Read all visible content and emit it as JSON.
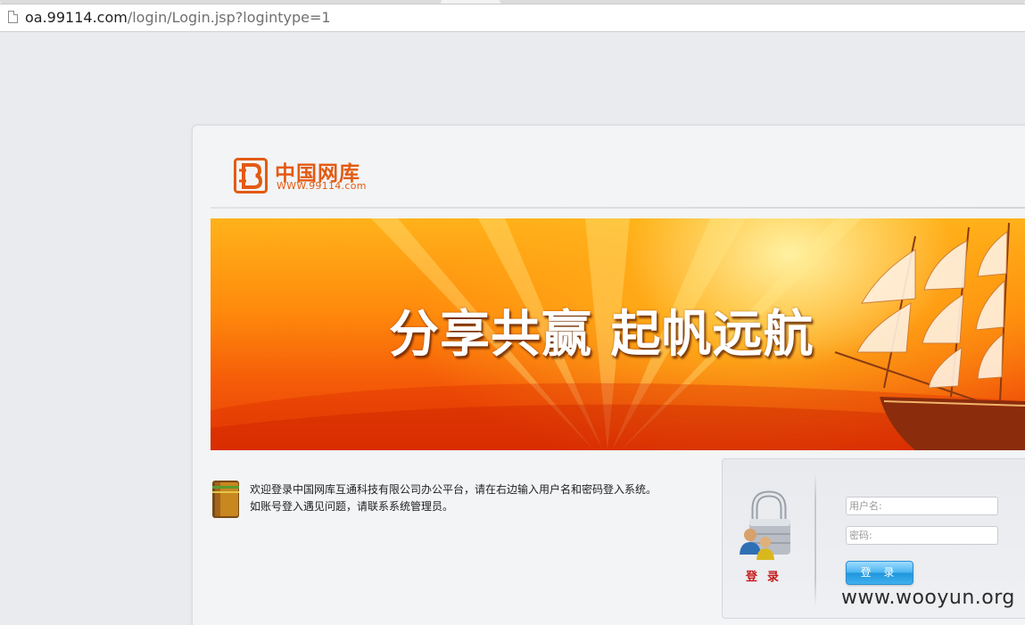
{
  "browser": {
    "url_host": "oa.99114.com",
    "url_path": "/login/Login.jsp?logintype=1"
  },
  "logo": {
    "name_cn": "中国网库",
    "site": "WWW.99114.com",
    "color": "#e45a12"
  },
  "banner": {
    "slogan": "分享共赢 起帆远航"
  },
  "welcome": {
    "line1": "欢迎登录中国网库互通科技有限公司办公平台，请在右边输入用户名和密码登入系统。",
    "line2": "如账号登入遇见问题，请联系系统管理员。"
  },
  "login": {
    "caption": "登录",
    "username_placeholder": "用户名:",
    "password_placeholder": "密码:",
    "button_label": "登 录",
    "button_color": "#1e95dc",
    "caption_color": "#c61a1a"
  },
  "watermark": "www.wooyun.org"
}
